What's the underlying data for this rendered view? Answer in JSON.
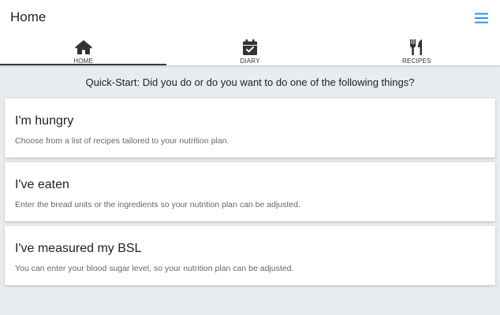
{
  "header": {
    "title": "Home",
    "menu_icon": "hamburger-menu-icon",
    "accent_color": "#2196f3"
  },
  "tabs": [
    {
      "label": "HOME",
      "icon": "home-icon",
      "active": true
    },
    {
      "label": "DIARY",
      "icon": "calendar-check-icon",
      "active": false
    },
    {
      "label": "RECIPES",
      "icon": "utensils-icon",
      "active": false
    }
  ],
  "main": {
    "quickstart": "Quick-Start: Did you do or do you want to do one of the following things?",
    "cards": [
      {
        "title": "I'm hungry",
        "description": "Choose from a list of recipes tailored to your nutrition plan."
      },
      {
        "title": "I've eaten",
        "description": "Enter the bread units or the ingredients so your nutrition plan can be adjusted."
      },
      {
        "title": "I've measured my BSL",
        "description": "You can enter your blood sugar level, so your nutrition plan can be adjusted."
      }
    ]
  }
}
